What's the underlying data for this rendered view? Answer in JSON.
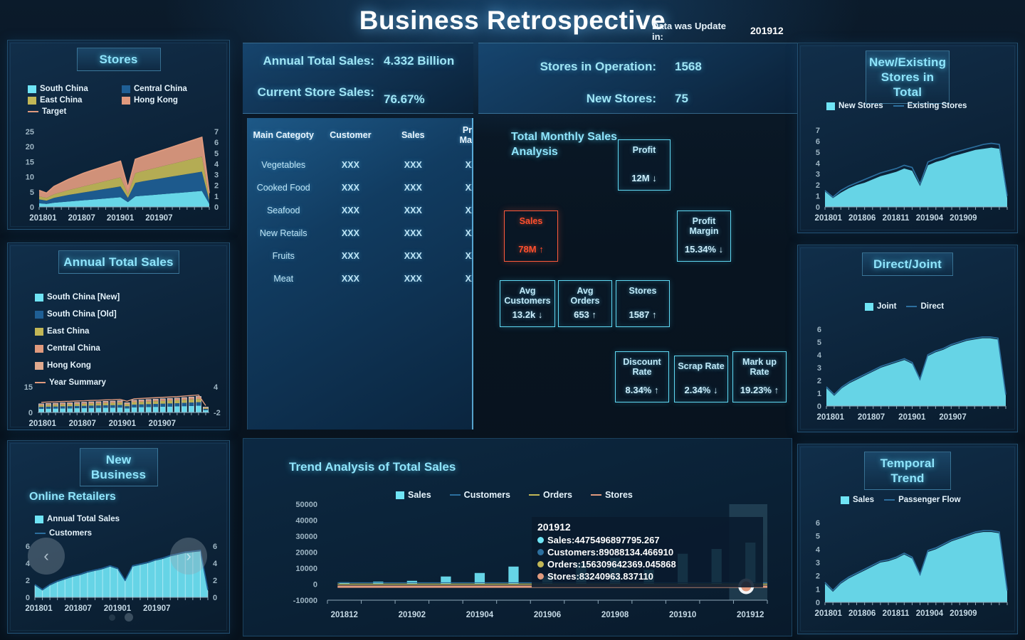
{
  "header": {
    "title": "Business Retrospective",
    "update_label": "Data was Update in:",
    "update_value": "201912"
  },
  "kpi_bar": {
    "left": [
      {
        "label": "Annual Total Sales:",
        "value": "4.332 Billion"
      },
      {
        "label": "Current Store Sales:",
        "value": "76.67%"
      }
    ],
    "right": [
      {
        "label": "Stores in Operation:",
        "value": "1568"
      },
      {
        "label": "New Stores:",
        "value": "75"
      }
    ]
  },
  "category_table": {
    "columns": [
      "Main Categoty",
      "Customer",
      "Sales",
      "Profit Margin"
    ],
    "rows": [
      {
        "category": "Vegetables",
        "customer": "XXX",
        "sales": "XXX",
        "profit_margin": "XXX"
      },
      {
        "category": "Cooked Food",
        "customer": "XXX",
        "sales": "XXX",
        "profit_margin": "XXX"
      },
      {
        "category": "Seafood",
        "customer": "XXX",
        "sales": "XXX",
        "profit_margin": "XXX"
      },
      {
        "category": "New Retails",
        "customer": "XXX",
        "sales": "XXX",
        "profit_margin": "XXX"
      },
      {
        "category": "Fruits",
        "customer": "XXX",
        "sales": "XXX",
        "profit_margin": "XXX"
      },
      {
        "category": "Meat",
        "customer": "XXX",
        "sales": "XXX",
        "profit_margin": "XXX"
      }
    ]
  },
  "monthly_analysis": {
    "title": "Total Monthly Sales Analysis",
    "cards": [
      {
        "name": "Profit",
        "value": "12M ↓",
        "alert": false
      },
      {
        "name": "Sales",
        "value": "78M ↑",
        "alert": true
      },
      {
        "name": "Profit Margin",
        "value": "15.34% ↓",
        "alert": false
      },
      {
        "name": "Avg Customers",
        "value": "13.2k ↓",
        "alert": false
      },
      {
        "name": "Avg Orders",
        "value": "653 ↑",
        "alert": false
      },
      {
        "name": "Stores",
        "value": "1587 ↑",
        "alert": false
      },
      {
        "name": "Discount Rate",
        "value": "8.34% ↑",
        "alert": false
      },
      {
        "name": "Scrap Rate",
        "value": "2.34% ↓",
        "alert": false
      },
      {
        "name": "Mark up Rate",
        "value": "19.23% ↑",
        "alert": false
      }
    ]
  },
  "colors": {
    "cyan": "#6fe4f5",
    "blue": "#1f5f95",
    "olive": "#c2b756",
    "salmon": "#e09a7e",
    "alert": "#ff4f2e",
    "bg": "#081420",
    "panel": "#0e2740"
  },
  "chart_data": [
    {
      "id": "stores",
      "type": "area",
      "title": "Stores",
      "legend": [
        {
          "name": "South China",
          "color": "#6fe4f5",
          "kind": "area"
        },
        {
          "name": "Central China",
          "color": "#1f5f95",
          "kind": "area"
        },
        {
          "name": "East China",
          "color": "#c2b756",
          "kind": "area"
        },
        {
          "name": "Hong Kong",
          "color": "#e09a7e",
          "kind": "area"
        },
        {
          "name": "Target",
          "color": "#e09a7e",
          "kind": "line"
        }
      ],
      "legend_position": "top",
      "xlabel": "",
      "ylabel": "",
      "ylim": [
        0,
        25
      ],
      "y2lim": [
        0,
        7
      ],
      "yticks": [
        0,
        5,
        10,
        15,
        20,
        25
      ],
      "y2ticks": [
        0,
        1,
        2,
        3,
        4,
        5,
        6,
        7
      ],
      "xticklabels": [
        "201801",
        "201807",
        "201901",
        "201907"
      ],
      "x": [
        "201801",
        "201802",
        "201803",
        "201804",
        "201805",
        "201806",
        "201807",
        "201808",
        "201809",
        "201810",
        "201811",
        "201812",
        "201901",
        "201902",
        "201903",
        "201904",
        "201905",
        "201906",
        "201907",
        "201908",
        "201909",
        "201910",
        "201911",
        "201912"
      ],
      "series": [
        {
          "name": "South China",
          "values": [
            1.2,
            1.0,
            1.4,
            1.6,
            1.8,
            2.0,
            2.2,
            2.4,
            2.6,
            2.8,
            3.0,
            3.2,
            1.6,
            3.5,
            3.7,
            3.9,
            4.1,
            4.3,
            4.5,
            4.7,
            4.9,
            5.1,
            5.3,
            1.0
          ]
        },
        {
          "name": "Central China",
          "values": [
            1.3,
            1.1,
            1.6,
            1.9,
            2.2,
            2.4,
            2.6,
            2.8,
            3.0,
            3.2,
            3.4,
            3.6,
            1.4,
            4.5,
            4.8,
            5.0,
            5.2,
            5.4,
            5.6,
            5.8,
            6.0,
            6.2,
            6.4,
            1.2
          ]
        },
        {
          "name": "East China",
          "values": [
            1.0,
            0.9,
            1.2,
            1.4,
            1.6,
            1.8,
            2.0,
            2.2,
            2.4,
            2.6,
            2.8,
            3.0,
            1.2,
            3.2,
            3.4,
            3.6,
            3.8,
            4.0,
            4.2,
            4.4,
            4.6,
            4.8,
            5.0,
            0.9
          ]
        },
        {
          "name": "Hong Kong",
          "values": [
            2.0,
            1.6,
            2.6,
            3.1,
            3.6,
            4.0,
            4.4,
            4.6,
            4.8,
            5.0,
            5.2,
            5.4,
            2.2,
            4.6,
            4.8,
            5.0,
            5.2,
            5.4,
            5.6,
            5.8,
            6.0,
            6.2,
            6.4,
            1.5
          ]
        },
        {
          "name": "Target",
          "kind": "line",
          "values": [
            5.5,
            4.6,
            6.8,
            8.0,
            9.2,
            10.2,
            11.2,
            12.0,
            12.8,
            13.6,
            14.4,
            15.2,
            6.4,
            15.8,
            16.7,
            17.5,
            18.3,
            19.1,
            19.9,
            20.7,
            21.5,
            22.3,
            23.1,
            4.6
          ]
        }
      ]
    },
    {
      "id": "annual-total-sales",
      "type": "bar",
      "title": "Annual Total Sales",
      "legend": [
        {
          "name": "South China [New]",
          "color": "#6fe4f5",
          "kind": "area"
        },
        {
          "name": "South China [Old]",
          "color": "#1f5f95",
          "kind": "area"
        },
        {
          "name": "East China",
          "color": "#c2b756",
          "kind": "area"
        },
        {
          "name": "Central China",
          "color": "#e09a7e",
          "kind": "area"
        },
        {
          "name": "Hong Kong",
          "color": "#e0a98e",
          "kind": "area"
        },
        {
          "name": "Year Summary",
          "color": "#e09a7e",
          "kind": "line"
        }
      ],
      "legend_position": "top",
      "ylim": [
        0,
        15
      ],
      "y2lim": [
        -2,
        4
      ],
      "yticks": [
        0,
        15
      ],
      "y2ticks": [
        -2,
        4
      ],
      "xticklabels": [
        "201801",
        "201807",
        "201901",
        "201907"
      ],
      "categories": [
        "201801",
        "201802",
        "201803",
        "201804",
        "201805",
        "201806",
        "201807",
        "201808",
        "201809",
        "201810",
        "201811",
        "201812",
        "201901",
        "201902",
        "201903",
        "201904",
        "201905",
        "201906",
        "201907",
        "201908",
        "201909",
        "201910",
        "201911",
        "201912"
      ],
      "values": [
        4.8,
        5.0,
        5.1,
        5.3,
        5.4,
        5.6,
        5.7,
        5.9,
        6.0,
        6.2,
        6.3,
        6.5,
        5.4,
        6.8,
        7.0,
        7.2,
        7.4,
        7.6,
        7.8,
        8.0,
        8.3,
        8.6,
        8.9,
        3.0
      ]
    },
    {
      "id": "new-business",
      "type": "area",
      "title": "New Business",
      "subtitle": "Online Retailers",
      "legend": [
        {
          "name": "Annual Total Sales",
          "color": "#6fe4f5",
          "kind": "area"
        },
        {
          "name": "Customers",
          "color": "#1f5f95",
          "kind": "line"
        }
      ],
      "legend_position": "top",
      "ylim": [
        0,
        6
      ],
      "y2lim": [
        0,
        6
      ],
      "yticks": [
        0,
        2,
        4,
        6
      ],
      "y2ticks": [
        0,
        2,
        4,
        6
      ],
      "xticklabels": [
        "201801",
        "201807",
        "201901",
        "201907"
      ],
      "x": [
        "201801",
        "201802",
        "201803",
        "201804",
        "201805",
        "201806",
        "201807",
        "201808",
        "201809",
        "201810",
        "201811",
        "201812",
        "201901",
        "201902",
        "201903",
        "201904",
        "201905",
        "201906",
        "201907",
        "201908",
        "201909",
        "201910",
        "201911",
        "201912"
      ],
      "series": [
        {
          "name": "Annual Total Sales",
          "values": [
            1.4,
            0.8,
            1.4,
            1.8,
            2.1,
            2.4,
            2.6,
            2.9,
            3.1,
            3.3,
            3.6,
            3.3,
            1.9,
            3.6,
            3.8,
            4.0,
            4.3,
            4.5,
            4.8,
            5.0,
            5.2,
            5.3,
            5.4,
            0.8
          ]
        },
        {
          "name": "Customers",
          "kind": "line",
          "values": [
            1.5,
            0.9,
            1.5,
            1.9,
            2.2,
            2.5,
            2.7,
            3.0,
            3.2,
            3.4,
            3.7,
            3.4,
            2.0,
            3.7,
            3.9,
            4.1,
            4.4,
            4.6,
            4.9,
            5.1,
            5.3,
            5.4,
            5.5,
            0.9
          ]
        }
      ],
      "carousel": {
        "prev": "‹",
        "next": "›",
        "dots": 2,
        "active_dot": 1
      }
    },
    {
      "id": "new-existing-stores",
      "type": "area",
      "title": "New/Existing Stores in Total",
      "legend": [
        {
          "name": "New Stores",
          "color": "#6fe4f5",
          "kind": "area"
        },
        {
          "name": "Existing Stores",
          "color": "#2c6f9e",
          "kind": "line"
        }
      ],
      "legend_position": "top",
      "ylim": [
        0,
        7
      ],
      "yticks": [
        0,
        1,
        2,
        3,
        4,
        5,
        6,
        7
      ],
      "xticklabels": [
        "201801",
        "201806",
        "201811",
        "201904",
        "201909"
      ],
      "x": [
        "201801",
        "201802",
        "201803",
        "201804",
        "201805",
        "201806",
        "201807",
        "201808",
        "201809",
        "201810",
        "201811",
        "201812",
        "201901",
        "201902",
        "201903",
        "201904",
        "201905",
        "201906",
        "201907",
        "201908",
        "201909",
        "201910",
        "201911",
        "201912"
      ],
      "series": [
        {
          "name": "New Stores",
          "values": [
            1.4,
            0.8,
            1.3,
            1.7,
            2.0,
            2.2,
            2.5,
            2.8,
            3.0,
            3.2,
            3.5,
            3.3,
            1.9,
            3.8,
            4.1,
            4.3,
            4.6,
            4.8,
            5.0,
            5.2,
            5.3,
            5.4,
            5.3,
            0.8
          ]
        },
        {
          "name": "Existing Stores",
          "kind": "line",
          "values": [
            1.5,
            0.9,
            1.5,
            1.9,
            2.2,
            2.5,
            2.8,
            3.1,
            3.3,
            3.5,
            3.8,
            3.6,
            2.1,
            4.1,
            4.4,
            4.6,
            4.9,
            5.1,
            5.3,
            5.5,
            5.7,
            5.8,
            5.7,
            1.0
          ]
        }
      ]
    },
    {
      "id": "direct-joint",
      "type": "area",
      "title": "Direct/Joint",
      "legend": [
        {
          "name": "Joint",
          "color": "#6fe4f5",
          "kind": "area"
        },
        {
          "name": "Direct",
          "color": "#2c6f9e",
          "kind": "line"
        }
      ],
      "legend_position": "top",
      "ylim": [
        0,
        6
      ],
      "yticks": [
        0,
        1,
        2,
        3,
        4,
        5,
        6
      ],
      "xticklabels": [
        "201801",
        "201807",
        "201901",
        "201907"
      ],
      "x": [
        "201801",
        "201802",
        "201803",
        "201804",
        "201805",
        "201806",
        "201807",
        "201808",
        "201809",
        "201810",
        "201811",
        "201812",
        "201901",
        "201902",
        "201903",
        "201904",
        "201905",
        "201906",
        "201907",
        "201908",
        "201909",
        "201910",
        "201911",
        "201912"
      ],
      "series": [
        {
          "name": "Joint",
          "values": [
            1.4,
            0.8,
            1.4,
            1.8,
            2.1,
            2.4,
            2.7,
            3.0,
            3.2,
            3.4,
            3.6,
            3.3,
            2.0,
            3.9,
            4.2,
            4.4,
            4.7,
            4.9,
            5.1,
            5.2,
            5.3,
            5.3,
            5.2,
            0.8
          ]
        },
        {
          "name": "Direct",
          "kind": "line",
          "values": [
            1.5,
            0.9,
            1.5,
            1.9,
            2.2,
            2.5,
            2.8,
            3.1,
            3.3,
            3.5,
            3.7,
            3.4,
            2.1,
            4.0,
            4.3,
            4.5,
            4.8,
            5.0,
            5.2,
            5.3,
            5.4,
            5.4,
            5.3,
            0.9
          ]
        }
      ]
    },
    {
      "id": "temporal-trend",
      "type": "area",
      "title": "Temporal Trend",
      "legend": [
        {
          "name": "Sales",
          "color": "#6fe4f5",
          "kind": "area"
        },
        {
          "name": "Passenger Flow",
          "color": "#2c6f9e",
          "kind": "line"
        }
      ],
      "legend_position": "top",
      "ylim": [
        0,
        6
      ],
      "yticks": [
        0,
        1,
        2,
        3,
        4,
        5,
        6
      ],
      "xticklabels": [
        "201801",
        "201806",
        "201811",
        "201904",
        "201909"
      ],
      "x": [
        "201801",
        "201802",
        "201803",
        "201804",
        "201805",
        "201806",
        "201807",
        "201808",
        "201809",
        "201810",
        "201811",
        "201812",
        "201901",
        "201902",
        "201903",
        "201904",
        "201905",
        "201906",
        "201907",
        "201908",
        "201909",
        "201910",
        "201911",
        "201912"
      ],
      "series": [
        {
          "name": "Sales",
          "values": [
            1.4,
            0.8,
            1.4,
            1.8,
            2.1,
            2.4,
            2.7,
            3.0,
            3.1,
            3.3,
            3.6,
            3.3,
            2.0,
            3.8,
            4.0,
            4.3,
            4.6,
            4.8,
            5.0,
            5.2,
            5.3,
            5.3,
            5.2,
            0.8
          ]
        },
        {
          "name": "Passenger Flow",
          "kind": "line",
          "values": [
            1.5,
            0.9,
            1.5,
            1.9,
            2.2,
            2.5,
            2.8,
            3.1,
            3.2,
            3.4,
            3.7,
            3.4,
            2.1,
            3.9,
            4.1,
            4.4,
            4.7,
            4.9,
            5.1,
            5.3,
            5.4,
            5.4,
            5.3,
            0.9
          ]
        }
      ]
    },
    {
      "id": "trend-analysis",
      "type": "bar",
      "title": "Trend Analysis of Total Sales",
      "legend": [
        {
          "name": "Sales",
          "color": "#6fe4f5",
          "kind": "area"
        },
        {
          "name": "Customers",
          "color": "#2c6f9e",
          "kind": "line"
        },
        {
          "name": "Orders",
          "color": "#c2b756",
          "kind": "line"
        },
        {
          "name": "Stores",
          "color": "#e09a7e",
          "kind": "line"
        }
      ],
      "legend_position": "top",
      "ylim": [
        -10000,
        50000
      ],
      "yticks": [
        -10000,
        0,
        10000,
        20000,
        30000,
        40000,
        50000
      ],
      "yticklabels": [
        "-10000",
        "0",
        "10000",
        "20000",
        "30000",
        "40000",
        "50000"
      ],
      "xticklabels": [
        "201812",
        "201902",
        "201904",
        "201906",
        "201908",
        "201910",
        "201912"
      ],
      "categories": [
        "201812",
        "201901",
        "201902",
        "201903",
        "201904",
        "201905",
        "201906",
        "201907",
        "201908",
        "201909",
        "201910",
        "201911",
        "201912"
      ],
      "values": [
        1200,
        1600,
        2100,
        4800,
        7000,
        11000,
        5200,
        13000,
        16500,
        9000,
        19000,
        22000,
        26000
      ],
      "grid": false,
      "tooltip": {
        "date": "201912",
        "items": [
          {
            "label": "Sales",
            "value": "4475496897795.267",
            "color": "#6fe4f5"
          },
          {
            "label": "Customers",
            "value": "89088134.466910",
            "color": "#2c6f9e"
          },
          {
            "label": "Orders",
            "value": "156309642369.045868",
            "color": "#c2b756"
          },
          {
            "label": "Stores",
            "value": "83240963.837110",
            "color": "#e09a7e"
          }
        ]
      }
    }
  ]
}
